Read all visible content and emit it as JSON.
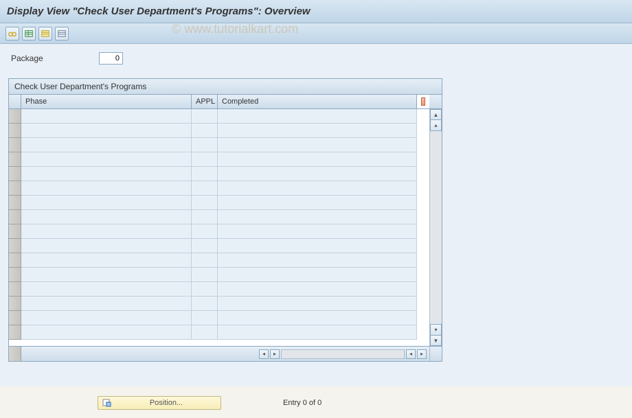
{
  "title": "Display View \"Check User Department's Programs\": Overview",
  "watermark": "© www.tutorialkart.com",
  "toolbar": {
    "glasses_label": "Display/Change",
    "table_settings_label": "Table Settings",
    "select_all_label": "Select All",
    "deselect_all_label": "Deselect All"
  },
  "field": {
    "package_label": "Package",
    "package_value": "0"
  },
  "table": {
    "title": "Check User Department's Programs",
    "columns": {
      "phase": "Phase",
      "appl": "APPL",
      "completed": "Completed"
    },
    "row_count": 16
  },
  "footer": {
    "position_label": "Position...",
    "entry_text": "Entry 0 of 0"
  }
}
